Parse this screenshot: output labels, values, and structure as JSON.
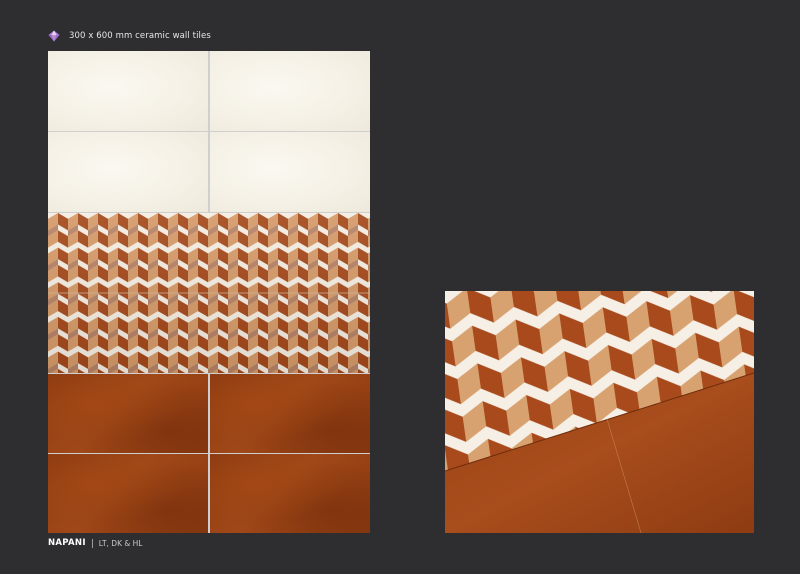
{
  "header": {
    "icon": "diamond-logo-icon",
    "text": "300 x 600 mm ceramic wall tiles"
  },
  "footer": {
    "brand": "NAPANI",
    "variants": "LT, DK & HL"
  },
  "colors": {
    "background": "#2e2e31",
    "light_tile": "#f5f1e6",
    "dark_tile": "#9a4316",
    "pattern_tan": "#c98a56",
    "pattern_rust": "#a4481a"
  }
}
